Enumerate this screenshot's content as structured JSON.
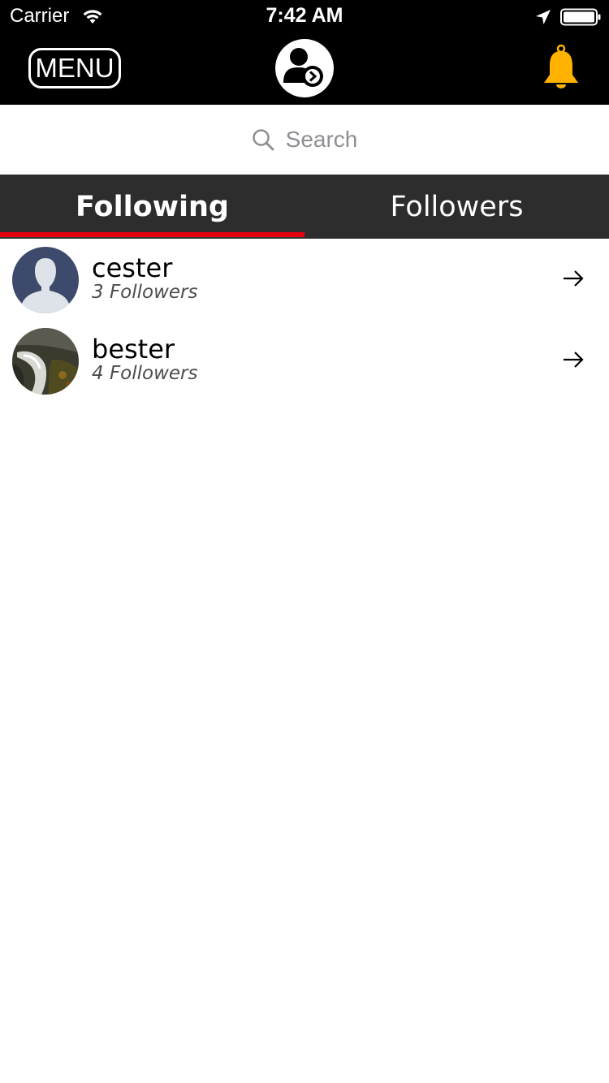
{
  "status_bar": {
    "carrier": "Carrier",
    "time": "7:42 AM"
  },
  "nav": {
    "menu_label": "MENU",
    "profile_icon": "user-profile-arrow-icon",
    "notification_icon": "bell-icon",
    "bell_color": "#ffb300"
  },
  "search": {
    "placeholder": "Search"
  },
  "tabs": [
    {
      "label": "Following",
      "selected": true
    },
    {
      "label": "Followers",
      "selected": false
    }
  ],
  "colors": {
    "tab_indicator": "#e3000f",
    "tab_bar": "#2d2d2d",
    "nav_bar": "#000000"
  },
  "users": [
    {
      "name": "cester",
      "followers": "3 Followers",
      "avatar": "default-person-avatar"
    },
    {
      "name": "bester",
      "followers": "4 Followers",
      "avatar": "waterfall-photo-avatar"
    }
  ]
}
